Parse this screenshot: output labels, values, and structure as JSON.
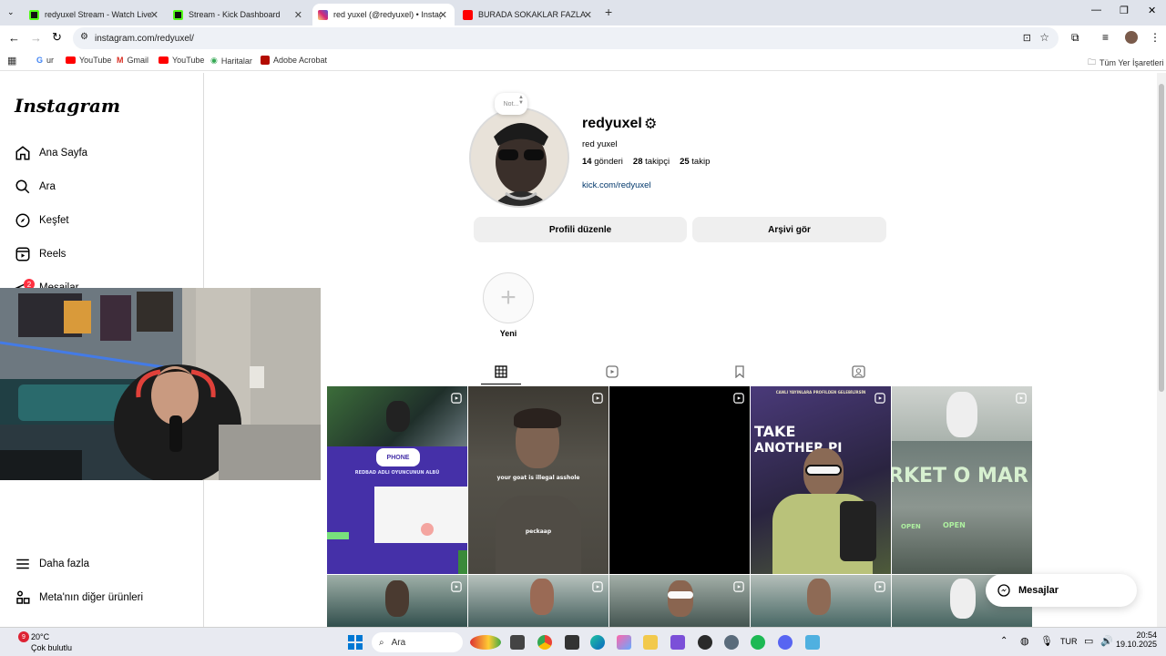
{
  "browser": {
    "tabs": [
      {
        "title": "redyuxel Stream - Watch Live o",
        "color": "#53fc18"
      },
      {
        "title": "Stream - Kick Dashboard",
        "color": "#53fc18"
      },
      {
        "title": "red yuxel (@redyuxel) • Instag",
        "color": "#d62976"
      },
      {
        "title": "BURADA SOKAKLAR FAZLACA",
        "color": "#ff0000"
      }
    ],
    "url": "instagram.com/redyuxel/",
    "bookmarks": [
      "ur",
      "YouTube",
      "Gmail",
      "YouTube",
      "Haritalar",
      "Adobe Acrobat"
    ],
    "all_bookmarks": "Tüm Yer İşaretleri"
  },
  "sidebar": {
    "logo": "Instagram",
    "items": [
      "Ana Sayfa",
      "Ara",
      "Keşfet",
      "Reels",
      "Mesajlar"
    ],
    "messages_badge": "2",
    "bottom_items": [
      "Daha fazla",
      "Meta'nın diğer ürünleri"
    ]
  },
  "profile": {
    "note": "Not...",
    "username": "redyuxel",
    "full_name": "red yuxel",
    "posts_count": "14",
    "posts_label": "gönderi",
    "followers_count": "28",
    "followers_label": "takipçi",
    "following_count": "25",
    "following_label": "takip",
    "link": "kick.com/redyuxel",
    "edit_button": "Profili düzenle",
    "archive_button": "Arşivi gör",
    "highlight_new": "Yeni"
  },
  "posts": {
    "overlay_1": "PHONE",
    "overlay_1b": "REDBAD ADLI OYUNCUNUN ALBÜ",
    "overlay_2": "your goat is illegal asshole",
    "overlay_2b": "peckaap",
    "overlay_4a": "TAKE",
    "overlay_4b": "ANOTHER PI",
    "overlay_4c": "CANLI YAYINLARA PROFILDEN GELEBİLİRSİN",
    "overlay_5": "RKET O MAR",
    "overlay_5b": "OPEN",
    "overlay_5c": "OPEN"
  },
  "messages_pill": "Mesajlar",
  "taskbar": {
    "weather_temp": "20°C",
    "weather_desc": "Çok bulutlu",
    "weather_badge": "9",
    "search": "Ara",
    "language": "TUR",
    "time": "20:54",
    "date": "19.10.2025"
  }
}
